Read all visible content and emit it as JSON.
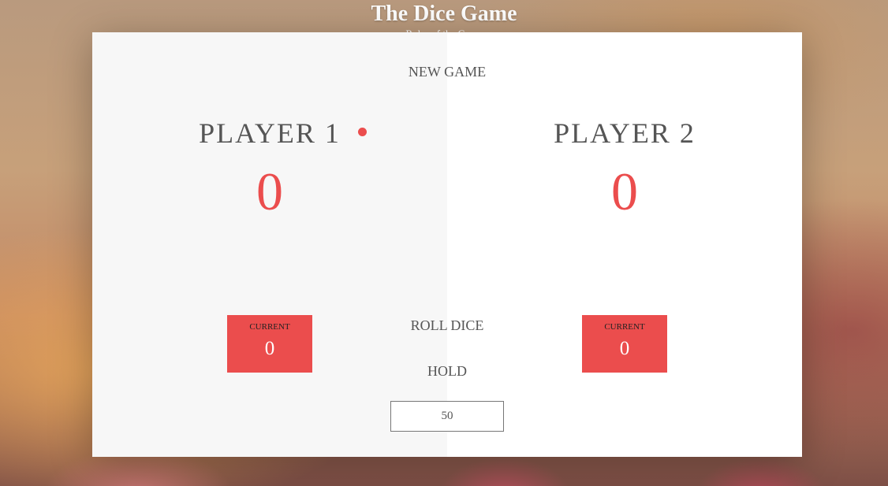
{
  "header": {
    "title": "The Dice Game",
    "rules_link": "Rules of the Game"
  },
  "players": [
    {
      "name": "PLAYER 1",
      "score": "0",
      "current_label": "CURRENT",
      "current_score": "0",
      "active": true
    },
    {
      "name": "PLAYER 2",
      "score": "0",
      "current_label": "CURRENT",
      "current_score": "0",
      "active": false
    }
  ],
  "controls": {
    "new_game": "NEW GAME",
    "roll_dice": "ROLL DICE",
    "hold": "HOLD",
    "final_score_value": "50"
  },
  "colors": {
    "accent": "#eb4d4d",
    "text": "#555555",
    "panel_left": "#f7f7f7",
    "panel_right": "#ffffff"
  }
}
